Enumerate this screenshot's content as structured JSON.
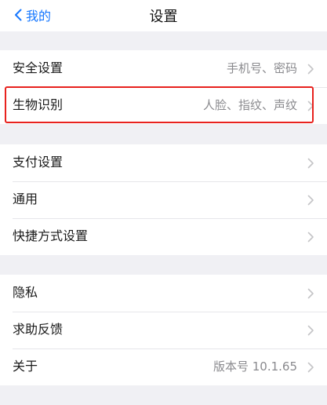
{
  "navbar": {
    "back_label": "我的",
    "title": "设置"
  },
  "groups": [
    {
      "rows": [
        {
          "label": "安全设置",
          "value": "手机号、密码"
        },
        {
          "label": "生物识别",
          "value": "人脸、指纹、声纹"
        }
      ]
    },
    {
      "rows": [
        {
          "label": "支付设置",
          "value": ""
        },
        {
          "label": "通用",
          "value": ""
        },
        {
          "label": "快捷方式设置",
          "value": ""
        }
      ]
    },
    {
      "rows": [
        {
          "label": "隐私",
          "value": ""
        },
        {
          "label": "求助反馈",
          "value": ""
        },
        {
          "label": "关于",
          "value": "版本号 10.1.65"
        }
      ]
    }
  ],
  "colors": {
    "accent": "#1677ff",
    "highlight": "#e8221e"
  }
}
